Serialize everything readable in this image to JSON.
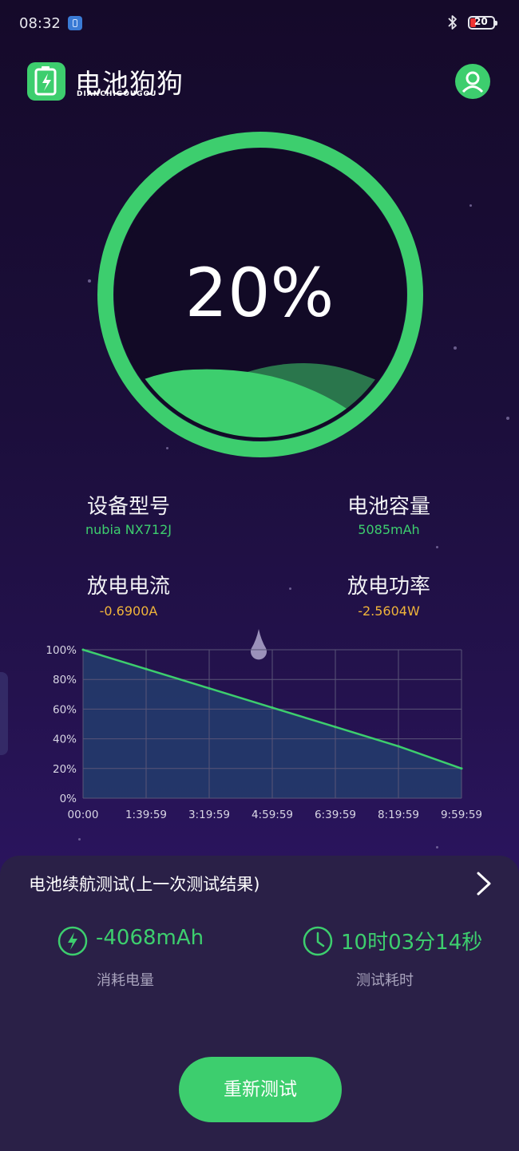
{
  "status_bar": {
    "time": "08:32",
    "battery_level": "20"
  },
  "header": {
    "app_name": "电池狗狗",
    "app_name_latin": "DIANCHIGOUGOU"
  },
  "gauge": {
    "percent_text": "20%",
    "level_fraction": 0.2
  },
  "device_info": {
    "model_label": "设备型号",
    "model_value": "nubia NX712J",
    "capacity_label": "电池容量",
    "capacity_value": "5085mAh",
    "current_label": "放电电流",
    "current_value": "-0.6900A",
    "power_label": "放电功率",
    "power_value": "-2.5604W"
  },
  "chart_data": {
    "type": "area",
    "x": [
      "00:00",
      "1:39:59",
      "3:19:59",
      "4:59:59",
      "6:39:59",
      "8:19:59",
      "9:59:59"
    ],
    "values": [
      100,
      87,
      74,
      61,
      48,
      35,
      20
    ],
    "y_ticks": [
      "100%",
      "80%",
      "60%",
      "40%",
      "20%",
      "0%"
    ],
    "ylim": [
      0,
      100
    ],
    "grid": true,
    "colors": {
      "line": "#3dce6e",
      "fill": "#243b6b",
      "grid": "#5a5578"
    }
  },
  "panel": {
    "title": "电池续航测试(上一次测试结果)",
    "consumed_value": "-4068mAh",
    "consumed_label": "消耗电量",
    "duration_value": "10时03分14秒",
    "duration_label": "测试耗时",
    "retest_button": "重新测试"
  },
  "colors": {
    "accent": "#3dce6e",
    "warning": "#f0b43a"
  }
}
